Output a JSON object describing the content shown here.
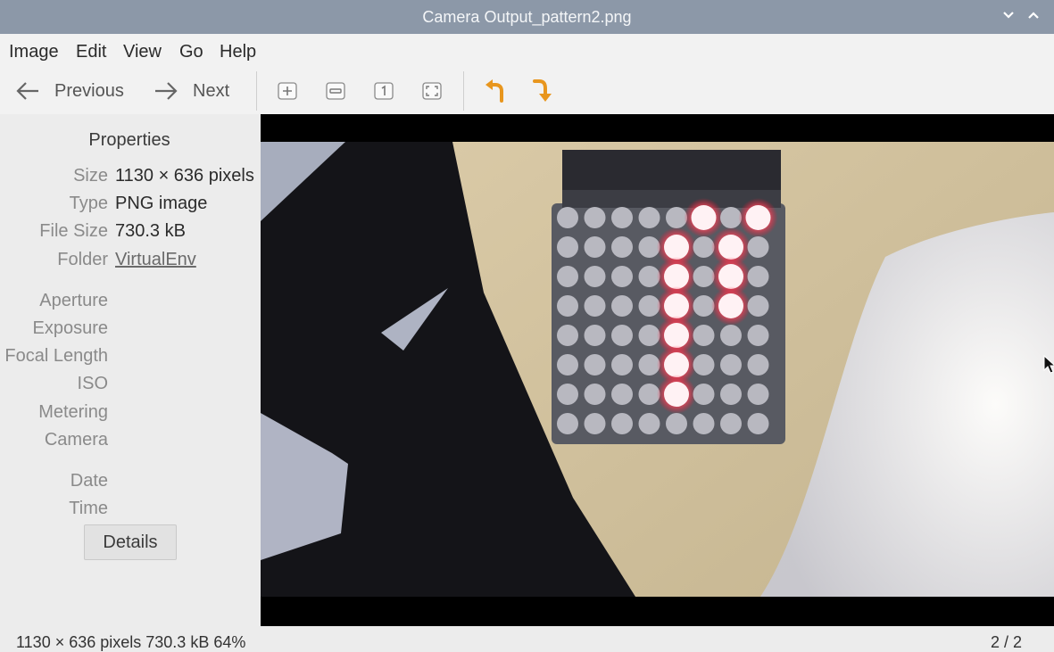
{
  "window": {
    "title": "Camera Output_pattern2.png"
  },
  "menu": [
    "Image",
    "Edit",
    "View",
    "Go",
    "Help"
  ],
  "toolbar": {
    "previous_label": "Previous",
    "next_label": "Next",
    "icons": [
      "zoom-in-icon",
      "zoom-out-icon",
      "zoom-normal-icon",
      "zoom-fit-icon",
      "rotate-left-icon",
      "rotate-right-icon"
    ],
    "accent_color": "#e8961e"
  },
  "properties": {
    "title": "Properties",
    "rows": [
      {
        "key": "Size",
        "value": "1130 × 636 pixels"
      },
      {
        "key": "Type",
        "value": "PNG image"
      },
      {
        "key": "File Size",
        "value": "730.3 kB"
      },
      {
        "key": "Folder",
        "value": "VirtualEnv"
      },
      {
        "key": "Aperture",
        "value": ""
      },
      {
        "key": "Exposure",
        "value": ""
      },
      {
        "key": "Focal Length",
        "value": ""
      },
      {
        "key": "ISO",
        "value": ""
      },
      {
        "key": "Metering",
        "value": ""
      },
      {
        "key": "Camera",
        "value": ""
      },
      {
        "key": "Date",
        "value": ""
      },
      {
        "key": "Time",
        "value": ""
      }
    ],
    "details_label": "Details"
  },
  "status": {
    "left": "1130 × 636 pixels  730.3 kB    64%",
    "right": "2 / 2"
  }
}
